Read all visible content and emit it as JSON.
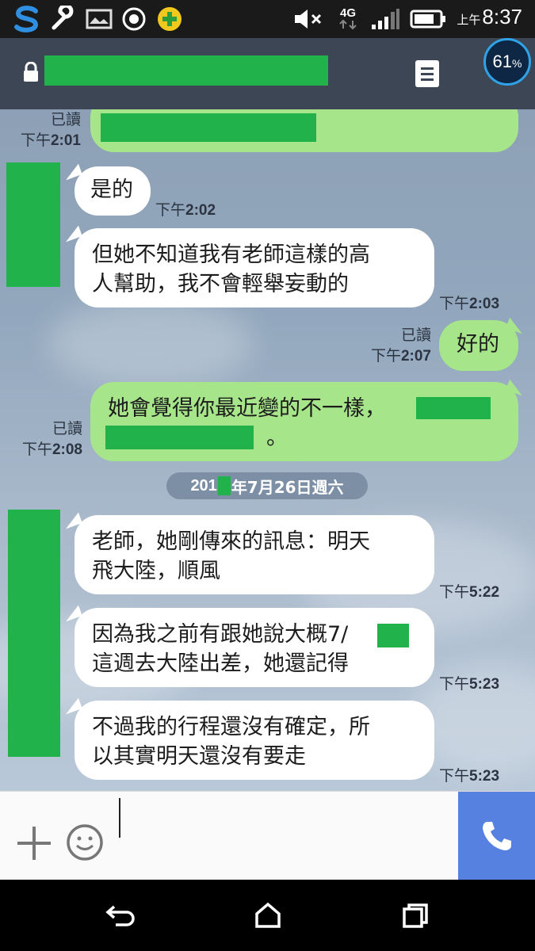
{
  "status_bar": {
    "ampm": "上午",
    "time": "8:37",
    "network": "4G",
    "battery_percent": "61",
    "battery_unit": "%"
  },
  "header": {
    "title": "",
    "lock_icon": "lock-icon",
    "menu_icon": "menu-list-icon"
  },
  "messages": {
    "m0": {
      "read": "已讀",
      "pm": "下午",
      "time": "2:01"
    },
    "m1": {
      "text": "是的",
      "pm": "下午",
      "time": "2:02"
    },
    "m2": {
      "line1": "但她不知道我有老師這樣的高",
      "line2": "人幫助，我不會輕舉妄動的",
      "pm": "下午",
      "time": "2:03"
    },
    "m3": {
      "text": "好的",
      "read": "已讀",
      "pm": "下午",
      "time": "2:07"
    },
    "m4": {
      "line1": "她會覺得你最近變的不一樣，",
      "line2_end": "。",
      "read": "已讀",
      "pm": "下午",
      "time": "2:08"
    },
    "date": {
      "prefix": "201",
      "rest": "年7月26日週六"
    },
    "m5": {
      "line1": "老師，她剛傳來的訊息：明天",
      "line2": "飛大陸，順風",
      "pm": "下午",
      "time": "5:22"
    },
    "m6": {
      "line1": "因為我之前有跟她說大概7/",
      "line2": "這週去大陸出差，她還記得",
      "pm": "下午",
      "time": "5:23"
    },
    "m7": {
      "line1": "不過我的行程還沒有確定，所",
      "line2": "以其實明天還沒有要走",
      "pm": "下午",
      "time": "5:23"
    }
  },
  "colors": {
    "header_bg": "#3d4654",
    "outgoing_bubble": "#a7e58a",
    "incoming_bubble": "#ffffff",
    "call_button": "#5681e0",
    "redaction": "#22b24c"
  }
}
